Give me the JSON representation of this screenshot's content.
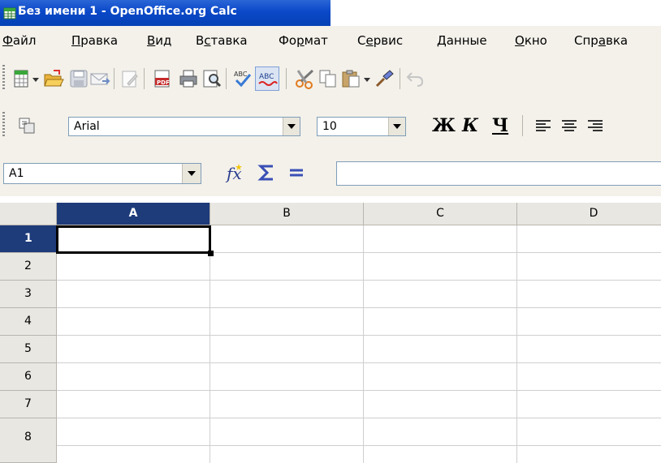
{
  "window": {
    "title": "Без имени 1 - OpenOffice.org Calc"
  },
  "menu": {
    "items": [
      {
        "pre": "",
        "u": "Ф",
        "post": "айл"
      },
      {
        "pre": "",
        "u": "П",
        "post": "равка"
      },
      {
        "pre": "",
        "u": "В",
        "post": "ид"
      },
      {
        "pre": "В",
        "u": "с",
        "post": "тавка"
      },
      {
        "pre": "Фо",
        "u": "р",
        "post": "мат"
      },
      {
        "pre": "С",
        "u": "е",
        "post": "рвис"
      },
      {
        "pre": "",
        "u": "Д",
        "post": "анные"
      },
      {
        "pre": "",
        "u": "О",
        "post": "кно"
      },
      {
        "pre": "Спр",
        "u": "а",
        "post": "вка"
      }
    ]
  },
  "format_toolbar": {
    "font_name": "Arial",
    "font_size": "10",
    "bold_label": "Ж",
    "italic_label": "К",
    "underline_label": "Ч"
  },
  "formula_bar": {
    "name_box": "A1",
    "formula": ""
  },
  "sheet": {
    "columns": [
      "A",
      "B",
      "C",
      "D"
    ],
    "rows": [
      "1",
      "2",
      "3",
      "4",
      "5",
      "6",
      "7",
      "8"
    ],
    "selected_cell": "A1"
  },
  "colors": {
    "titlebar": "#0a48c8",
    "header_selected": "#1e3b7a",
    "toolbar_bg": "#f3f1ea"
  }
}
